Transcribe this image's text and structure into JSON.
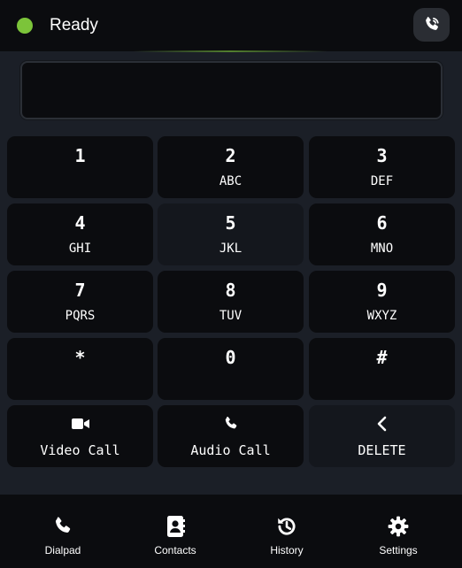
{
  "header": {
    "status": "Ready",
    "status_color": "#7cc43a",
    "call_log_icon": "phone-log-icon"
  },
  "display": {
    "value": ""
  },
  "keypad": {
    "keys": [
      {
        "digit": "1",
        "letters": ""
      },
      {
        "digit": "2",
        "letters": "ABC"
      },
      {
        "digit": "3",
        "letters": "DEF"
      },
      {
        "digit": "4",
        "letters": "GHI"
      },
      {
        "digit": "5",
        "letters": "JKL"
      },
      {
        "digit": "6",
        "letters": "MNO"
      },
      {
        "digit": "7",
        "letters": "PQRS"
      },
      {
        "digit": "8",
        "letters": "TUV"
      },
      {
        "digit": "9",
        "letters": "WXYZ"
      },
      {
        "digit": "*",
        "letters": ""
      },
      {
        "digit": "0",
        "letters": ""
      },
      {
        "digit": "#",
        "letters": ""
      }
    ],
    "actions": {
      "video_call": {
        "label": "Video Call",
        "icon": "video-camera-icon"
      },
      "audio_call": {
        "label": "Audio Call",
        "icon": "phone-icon"
      },
      "delete": {
        "label": "DELETE",
        "icon": "chevron-left-icon"
      }
    }
  },
  "bottom_nav": {
    "items": [
      {
        "label": "Dialpad",
        "icon": "phone-icon"
      },
      {
        "label": "Contacts",
        "icon": "contact-book-icon"
      },
      {
        "label": "History",
        "icon": "history-icon"
      },
      {
        "label": "Settings",
        "icon": "gear-icon"
      }
    ]
  },
  "colors": {
    "background": "#1b1f27",
    "panel": "#0b0c0f",
    "accent": "#7cc43a"
  }
}
